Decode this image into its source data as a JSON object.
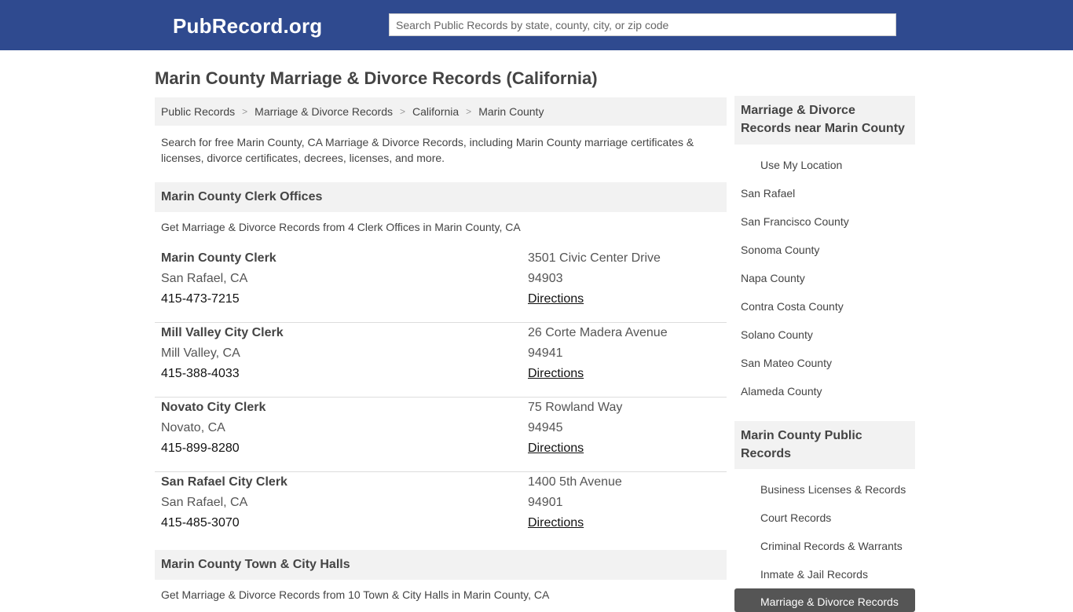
{
  "header": {
    "logo": "PubRecord.org",
    "search_placeholder": "Search Public Records by state, county, city, or zip code"
  },
  "page": {
    "title": "Marin County Marriage & Divorce Records (California)",
    "intro": "Search for free Marin County, CA Marriage & Divorce Records, including Marin County marriage certificates & licenses, divorce certificates, decrees, licenses, and more."
  },
  "breadcrumb": {
    "items": [
      "Public Records",
      "Marriage & Divorce Records",
      "California",
      "Marin County"
    ],
    "separator": ">"
  },
  "clerk_section": {
    "title": "Marin County Clerk Offices",
    "subtitle": "Get Marriage & Divorce Records from 4 Clerk Offices in Marin County, CA",
    "offices": [
      {
        "name": "Marin County Clerk",
        "city": "San Rafael, CA",
        "phone": "415-473-7215",
        "address": "3501 Civic Center Drive",
        "zip": "94903",
        "directions": "Directions"
      },
      {
        "name": "Mill Valley City Clerk",
        "city": "Mill Valley, CA",
        "phone": "415-388-4033",
        "address": "26 Corte Madera Avenue",
        "zip": "94941",
        "directions": "Directions"
      },
      {
        "name": "Novato City Clerk",
        "city": "Novato, CA",
        "phone": "415-899-8280",
        "address": "75 Rowland Way",
        "zip": "94945",
        "directions": "Directions"
      },
      {
        "name": "San Rafael City Clerk",
        "city": "San Rafael, CA",
        "phone": "415-485-3070",
        "address": "1400 5th Avenue",
        "zip": "94901",
        "directions": "Directions"
      }
    ]
  },
  "town_section": {
    "title": "Marin County Town & City Halls",
    "subtitle": "Get Marriage & Divorce Records from 10 Town & City Halls in Marin County, CA"
  },
  "sidebar": {
    "nearby": {
      "title": "Marriage & Divorce Records near Marin County",
      "use_location": "Use My Location",
      "items": [
        "San Rafael",
        "San Francisco County",
        "Sonoma County",
        "Napa County",
        "Contra Costa County",
        "Solano County",
        "San Mateo County",
        "Alameda County"
      ]
    },
    "public_records": {
      "title": "Marin County Public Records",
      "items": [
        "Business Licenses & Records",
        "Court Records",
        "Criminal Records & Warrants",
        "Inmate & Jail Records"
      ],
      "active_item": "Marriage & Divorce Records"
    }
  },
  "colors": {
    "header_bg": "#2f4a8f",
    "panel_bg": "#f2f2f2",
    "active_bg": "#555555"
  }
}
